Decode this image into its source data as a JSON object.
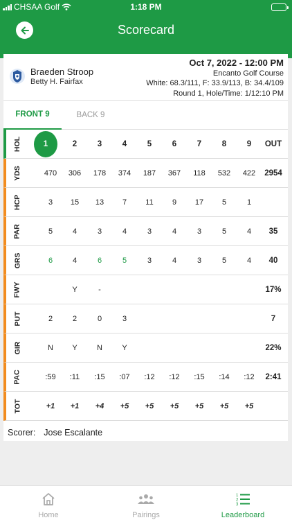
{
  "status": {
    "carrier": "CHSAA Golf",
    "time": "1:18 PM"
  },
  "header": {
    "title": "Scorecard"
  },
  "player": {
    "name": "Braeden Stroop",
    "school": "Betty H. Fairfax",
    "date": "Oct 7, 2022 - 12:00 PM",
    "course": "Encanto Golf Course",
    "tees": "White: 68.3/111, F: 33.9/113, B: 34.4/109",
    "round": "Round 1, Hole/Time: 1/12:10 PM"
  },
  "tabs": {
    "front": "FRONT 9",
    "back": "BACK 9"
  },
  "scorecard": {
    "headers": {
      "hol": "HOL",
      "holes": [
        "1",
        "2",
        "3",
        "4",
        "5",
        "6",
        "7",
        "8",
        "9"
      ],
      "total": "OUT"
    },
    "rows": [
      {
        "label": "YDS",
        "values": [
          "470",
          "306",
          "178",
          "374",
          "187",
          "367",
          "118",
          "532",
          "422"
        ],
        "total": "2954"
      },
      {
        "label": "HCP",
        "values": [
          "3",
          "15",
          "13",
          "7",
          "11",
          "9",
          "17",
          "5",
          "1"
        ],
        "total": ""
      },
      {
        "label": "PAR",
        "values": [
          "5",
          "4",
          "3",
          "4",
          "3",
          "4",
          "3",
          "5",
          "4"
        ],
        "total": "35"
      },
      {
        "label": "GRS",
        "values": [
          "6",
          "4",
          "6",
          "5",
          "3",
          "4",
          "3",
          "5",
          "4"
        ],
        "total": "40"
      },
      {
        "label": "FWY",
        "values": [
          "",
          "Y",
          "-",
          "",
          "",
          "",
          "",
          "",
          ""
        ],
        "total": "17%"
      },
      {
        "label": "PUT",
        "values": [
          "2",
          "2",
          "0",
          "3",
          "",
          "",
          "",
          "",
          ""
        ],
        "total": "7"
      },
      {
        "label": "GIR",
        "values": [
          "N",
          "Y",
          "N",
          "Y",
          "",
          "",
          "",
          "",
          ""
        ],
        "total": "22%"
      },
      {
        "label": "PAC",
        "values": [
          ":59",
          ":11",
          ":15",
          ":07",
          ":12",
          ":12",
          ":15",
          ":14",
          ":12"
        ],
        "total": "2:41"
      },
      {
        "label": "TOT",
        "values": [
          "+1",
          "+1",
          "+4",
          "+5",
          "+5",
          "+5",
          "+5",
          "+5",
          "+5"
        ],
        "total": ""
      }
    ]
  },
  "scorer": {
    "label": "Scorer:",
    "name": "Jose Escalante"
  },
  "nav": {
    "home": "Home",
    "pairings": "Pairings",
    "leaderboard": "Leaderboard"
  },
  "colors": {
    "brand": "#1e9a45",
    "accent_orange": "#f28c1f"
  }
}
